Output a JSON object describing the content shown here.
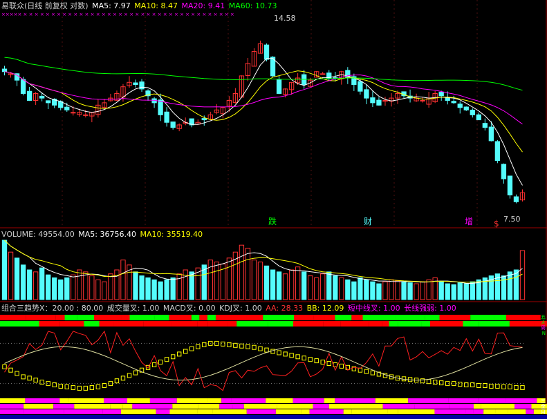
{
  "header": {
    "stock_title": "易联众(日线 前复权 对数)",
    "ma5": "MA5: 7.97",
    "ma10": "MA10: 8.47",
    "ma20": "MA20: 9.41",
    "ma60": "MA60: 10.73"
  },
  "price_panel": {
    "high_label": "14.58",
    "low_label": "7.50",
    "markers": [
      "跌",
      "财",
      "增",
      "$"
    ],
    "top_marks": "××××× × × × × × × × × × × × × × × × × × × × × × × × × × × × × × × × × × × × × × ×"
  },
  "volume_panel": {
    "volume": "VOLUME: 49554.00",
    "ma5": "MA5: 36756.40",
    "ma10": "MA10: 35519.40"
  },
  "indicator_panel": {
    "trend": "组合三趋势X：20.00 : 80.00",
    "cross": "成交量叉: 1.00",
    "macd": "MACD叉: 0.00",
    "kdj": "KDJ叉: 1.00",
    "aa": "AA: 28.33",
    "bb": "BB: 12.09",
    "short_mid": "短中线叉: 1.00",
    "long_line": "长线强弱: 1.00",
    "right_tags": [
      "五",
      "天",
      "周",
      "N",
      "三",
      "金",
      "月"
    ]
  },
  "colors": {
    "background": "#000000",
    "up": "#ff3232",
    "down": "#54fcfc",
    "ma5": "#ffffff",
    "ma10": "#ffff00",
    "ma20": "#ff00ff",
    "ma60": "#00ff00",
    "strip_red": "#ff0000",
    "strip_green": "#00ff00",
    "osc_yellow": "#ffff00",
    "osc_magenta": "#ff00ff"
  },
  "chart_data": {
    "type": "candlestick",
    "scale": "log",
    "y_range": [
      7.2,
      15.2
    ],
    "highest": 14.58,
    "lowest": 7.5,
    "close": [
      12.6,
      12.5,
      12.2,
      11.6,
      11.3,
      11.6,
      11.4,
      11.2,
      11.1,
      11.0,
      10.9,
      10.8,
      10.8,
      10.7,
      10.8,
      11.1,
      11.2,
      11.4,
      11.6,
      11.9,
      12.1,
      12.0,
      11.8,
      11.5,
      11.2,
      10.7,
      10.4,
      10.2,
      10.3,
      10.4,
      10.3,
      10.4,
      10.5,
      10.7,
      10.9,
      11.0,
      11.3,
      11.6,
      12.4,
      13.0,
      13.6,
      14.0,
      13.2,
      12.4,
      11.6,
      11.8,
      12.1,
      12.3,
      12.0,
      12.2,
      12.6,
      12.5,
      12.3,
      12.3,
      12.6,
      12.3,
      12.0,
      11.7,
      11.4,
      11.2,
      11.1,
      11.3,
      11.4,
      11.6,
      11.5,
      11.4,
      11.4,
      11.3,
      11.4,
      11.6,
      11.5,
      11.3,
      11.2,
      11.0,
      10.9,
      10.7,
      10.5,
      10.2,
      9.7,
      9.0,
      8.4,
      7.9,
      7.7,
      7.97
    ],
    "volume": [
      60,
      48,
      42,
      35,
      30,
      28,
      32,
      25,
      22,
      20,
      22,
      25,
      30,
      28,
      24,
      20,
      18,
      26,
      30,
      40,
      35,
      28,
      24,
      22,
      20,
      18,
      20,
      22,
      26,
      30,
      28,
      32,
      35,
      40,
      38,
      36,
      42,
      48,
      55,
      52,
      40,
      38,
      34,
      30,
      28,
      26,
      30,
      33,
      28,
      24,
      22,
      26,
      28,
      24,
      22,
      20,
      18,
      22,
      20,
      18,
      16,
      18,
      20,
      19,
      18,
      17,
      16,
      18,
      20,
      22,
      18,
      16,
      15,
      17,
      16,
      18,
      20,
      22,
      24,
      26,
      24,
      28,
      30,
      49.554
    ],
    "volume_ma5": 36756.4,
    "volume_ma10": 35519.4,
    "osc_values": [
      45,
      40,
      35,
      30,
      28,
      25,
      22,
      20,
      18,
      16,
      15,
      14,
      13,
      13,
      14,
      15,
      17,
      20,
      24,
      28,
      32,
      36,
      40,
      44,
      48,
      52,
      56,
      60,
      64,
      68,
      72,
      75,
      78,
      80,
      80,
      79,
      78,
      77,
      76,
      75,
      74,
      72,
      70,
      68,
      66,
      64,
      62,
      60,
      58,
      56,
      54,
      52,
      50,
      48,
      46,
      44,
      42,
      40,
      38,
      36,
      34,
      32,
      30,
      28,
      27,
      26,
      25,
      24,
      23,
      22,
      21,
      20,
      20,
      19,
      18,
      18,
      17,
      17,
      16,
      16,
      15,
      15,
      14,
      14
    ]
  }
}
